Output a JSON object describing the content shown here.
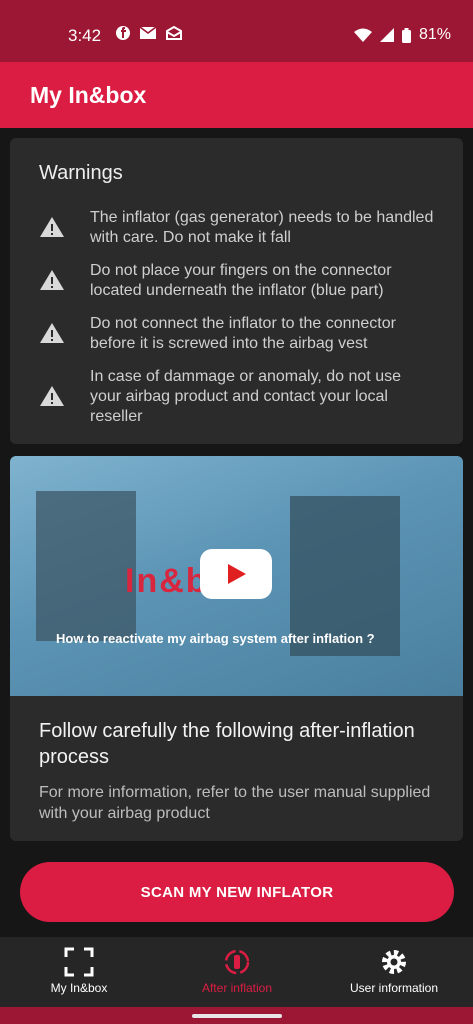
{
  "status_bar": {
    "time": "3:42",
    "battery": "81%",
    "left_icons": [
      "facebook-icon",
      "mail-icon",
      "inbox-icon"
    ],
    "right_icons": [
      "wifi-icon",
      "signal-icon",
      "battery-icon"
    ]
  },
  "app_bar": {
    "title": "My In&box"
  },
  "warnings": {
    "title": "Warnings",
    "items": [
      "The inflator (gas generator) needs to be handled with care. Do not make it fall",
      "Do not place your fingers on the connector located underneath the inflator (blue part)",
      "Do not connect the inflator to the connector before it is screwed into the airbag vest",
      "In case of dammage or anomaly, do not use your airbag product and contact your local reseller"
    ]
  },
  "video": {
    "brand_text": "In&box",
    "caption": "How to reactivate my airbag system after inflation ?"
  },
  "process": {
    "title": "Follow carefully the following after-inflation process",
    "subtitle": "For more information, refer to the user manual supplied with your airbag product"
  },
  "scan_button": {
    "label": "SCAN MY NEW INFLATOR"
  },
  "bottom_nav": {
    "items": [
      {
        "label": "My In&box",
        "icon": "scan-frame-icon",
        "active": false
      },
      {
        "label": "After inflation",
        "icon": "inflation-icon",
        "active": true
      },
      {
        "label": "User information",
        "icon": "gear-icon",
        "active": false
      }
    ]
  },
  "colors": {
    "accent": "#db1d43",
    "status_bar": "#9c1733",
    "card": "#2b2b2b",
    "background": "#161616",
    "nav_bg": "#262626"
  }
}
